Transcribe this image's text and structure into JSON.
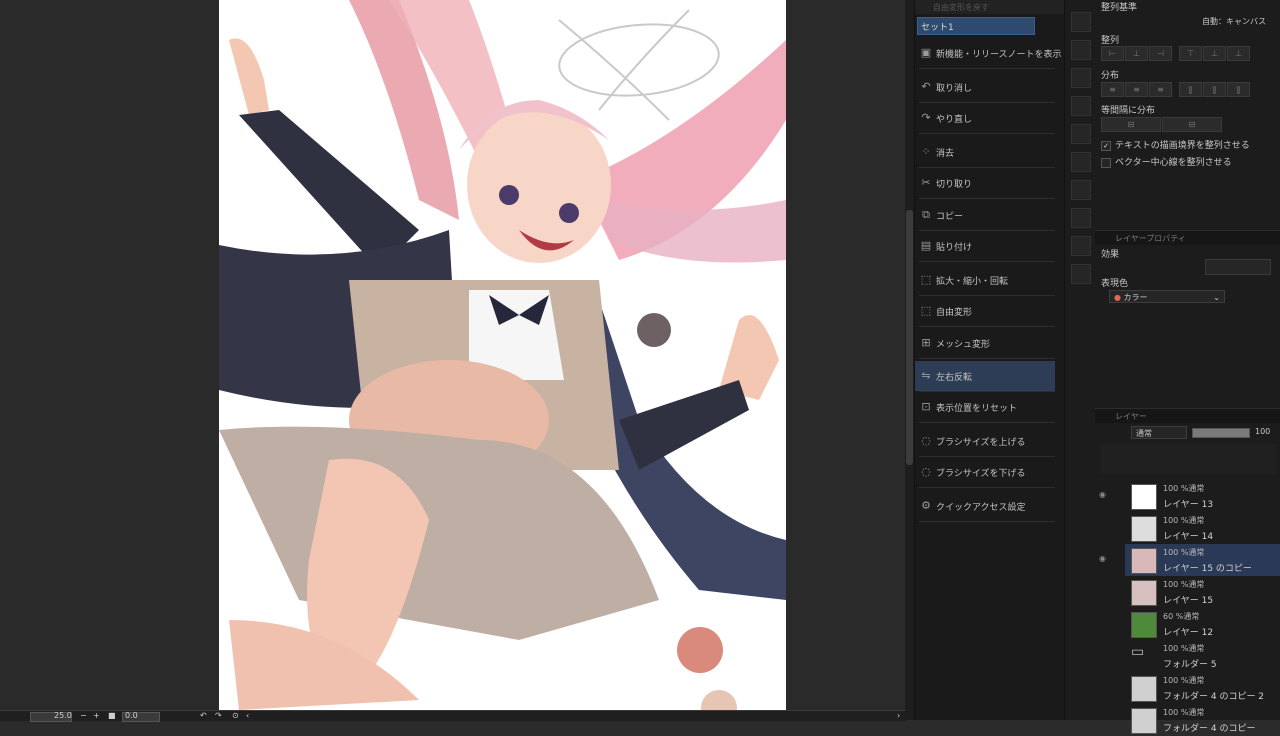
{
  "status": {
    "zoom": "25.0",
    "angle": "0.0"
  },
  "quick_access": {
    "header": "自由変形を戻す",
    "set_name": "セット1",
    "items": [
      {
        "label": "新機能・リリースノートを表示",
        "icon": "info-icon",
        "glyph": "▣"
      },
      {
        "label": "取り消し",
        "icon": "undo-icon",
        "glyph": "↶"
      },
      {
        "label": "やり直し",
        "icon": "redo-icon",
        "glyph": "↷"
      },
      {
        "label": "消去",
        "icon": "clear-icon",
        "glyph": "⁘"
      },
      {
        "label": "切り取り",
        "icon": "cut-icon",
        "glyph": "✂"
      },
      {
        "label": "コピー",
        "icon": "copy-icon",
        "glyph": "⧉"
      },
      {
        "label": "貼り付け",
        "icon": "paste-icon",
        "glyph": "▤"
      },
      {
        "label": "拡大・縮小・回転",
        "icon": "scale-rotate-icon",
        "glyph": "⬚"
      },
      {
        "label": "自由変形",
        "icon": "free-transform-icon",
        "glyph": "⬚"
      },
      {
        "label": "メッシュ変形",
        "icon": "mesh-transform-icon",
        "glyph": "⊞"
      },
      {
        "label": "左右反転",
        "icon": "flip-horizontal-icon",
        "glyph": "⇋"
      },
      {
        "label": "表示位置をリセット",
        "icon": "reset-view-icon",
        "glyph": "⊡"
      },
      {
        "label": "ブラシサイズを上げる",
        "icon": "brush-size-up-icon",
        "glyph": "◌"
      },
      {
        "label": "ブラシサイズを下げる",
        "icon": "brush-size-down-icon",
        "glyph": "◌"
      },
      {
        "label": "クイックアクセス設定",
        "icon": "quick-access-settings-icon",
        "glyph": "⚙"
      }
    ]
  },
  "align": {
    "title": "整列基準",
    "base_value": "自動：キャンバス",
    "align_label": "整列",
    "distribute_label": "分布",
    "distribute_equal_label": "等間隔に分布",
    "check_text_bounds": "テキストの描画境界を整列させる",
    "check_vector_center": "ベクター中心線を整列させる"
  },
  "layer_property": {
    "tab": "レイヤープロパティ",
    "effect_label": "効果",
    "expression_label": "表現色",
    "expression_value": "カラー"
  },
  "layers_panel": {
    "tab": "レイヤー",
    "blend_mode": "通常",
    "opacity": "100",
    "layers": [
      {
        "mode": "100 %通常",
        "name": "レイヤー 13",
        "visible": true,
        "selected": false,
        "thumb": "#ffffff"
      },
      {
        "mode": "100 %通常",
        "name": "レイヤー 14",
        "visible": false,
        "selected": false,
        "thumb": "#dddddd"
      },
      {
        "mode": "100 %通常",
        "name": "レイヤー 15 のコピー",
        "visible": true,
        "selected": true,
        "thumb": "#d8b8b8"
      },
      {
        "mode": "100 %通常",
        "name": "レイヤー 15",
        "visible": false,
        "selected": false,
        "thumb": "#d8c0c0"
      },
      {
        "mode": "60 %通常",
        "name": "レイヤー 12",
        "visible": false,
        "selected": false,
        "thumb": "#4f8a3a"
      },
      {
        "mode": "100 %通常",
        "name": "フォルダー 5",
        "visible": false,
        "selected": false,
        "thumb": "folder"
      },
      {
        "mode": "100 %通常",
        "name": "フォルダー 4 のコピー 2",
        "visible": false,
        "selected": false,
        "thumb": "#d0d0d0"
      },
      {
        "mode": "100 %通常",
        "name": "フォルダー 4 のコピー",
        "visible": false,
        "selected": false,
        "thumb": "#d0d0d0"
      }
    ]
  },
  "colors": {
    "accent": "#2e4a6e",
    "selected_row": "#2a3a56",
    "canvas_bg": "#ffffff",
    "panel_bg": "#1c1c1c"
  }
}
